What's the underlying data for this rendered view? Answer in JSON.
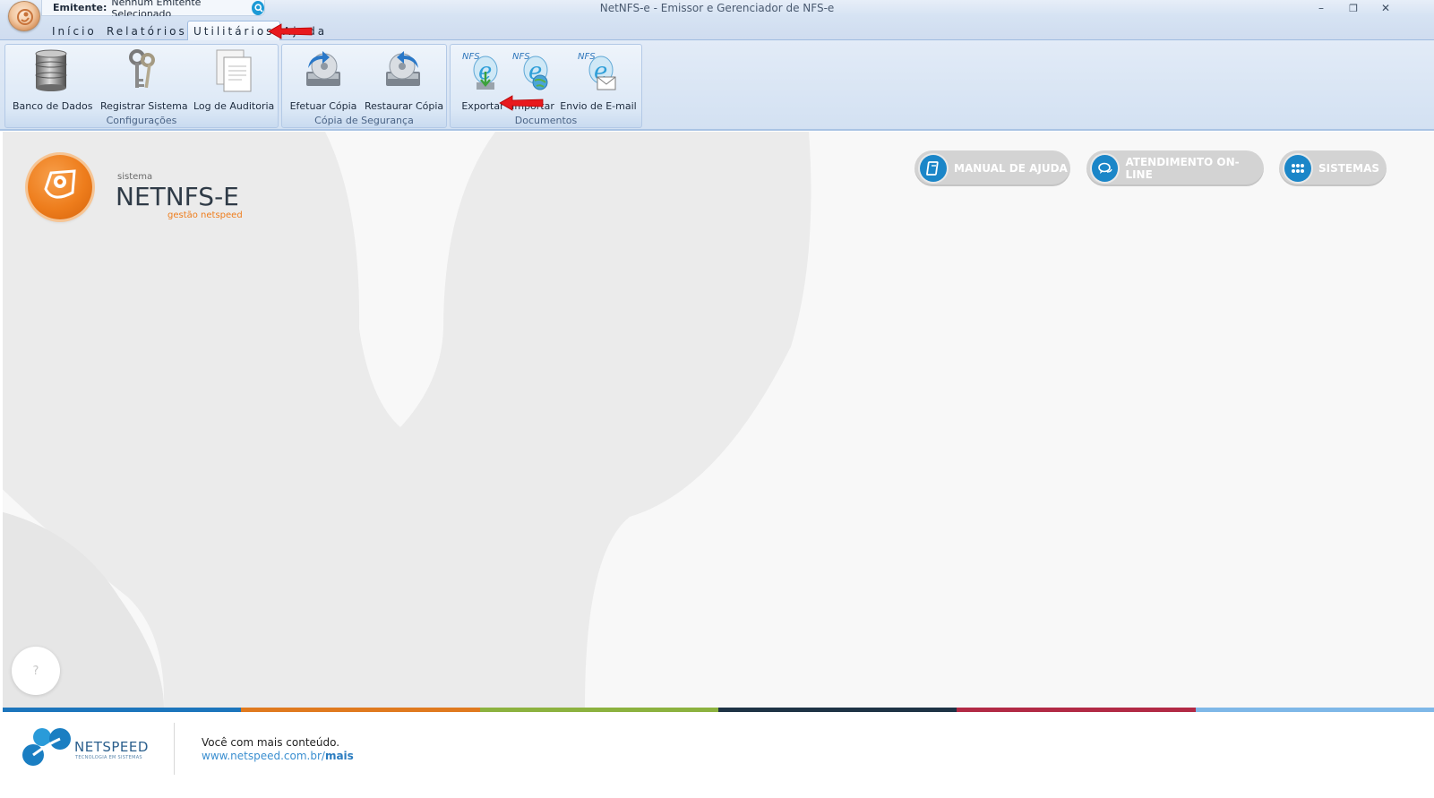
{
  "window": {
    "title": "NetNFS-e - Emissor e Gerenciador de NFS-e",
    "minimize_glyph": "–",
    "restore_glyph": "❐",
    "close_glyph": "✕"
  },
  "emitente": {
    "label": "Emitente:",
    "value": "Nenhum Emitente Selecionado"
  },
  "tabs": [
    {
      "label": "Início",
      "active": false
    },
    {
      "label": "Relatórios",
      "active": false
    },
    {
      "label": "Utilitários",
      "active": true
    },
    {
      "label": "Ajuda",
      "active": false
    }
  ],
  "ribbon": {
    "groups": [
      {
        "title": "Configurações",
        "buttons": [
          {
            "label": "Banco de Dados",
            "icon": "database-icon"
          },
          {
            "label": "Registrar Sistema",
            "icon": "keys-icon"
          },
          {
            "label": "Log de Auditoria",
            "icon": "document-log-icon"
          }
        ]
      },
      {
        "title": "Cópia de Segurança",
        "buttons": [
          {
            "label": "Efetuar Cópia",
            "icon": "backup-disc-icon"
          },
          {
            "label": "Restaurar Cópia",
            "icon": "restore-disc-icon"
          }
        ]
      },
      {
        "title": "Documentos",
        "buttons": [
          {
            "label": "Exportar",
            "icon": "nfse-export-icon"
          },
          {
            "label": "Importar",
            "icon": "nfse-import-icon"
          },
          {
            "label": "Envio de E-mail",
            "icon": "nfse-email-icon"
          }
        ]
      }
    ]
  },
  "product": {
    "small": "sistema",
    "name": "NETNFS-E",
    "sub": "gestão netspeed"
  },
  "actions": [
    {
      "label": "MANUAL DE AJUDA",
      "icon": "book-icon"
    },
    {
      "label": "ATENDIMENTO ON-LINE",
      "icon": "chat-icon"
    },
    {
      "label": "SISTEMAS",
      "icon": "grid-dots-icon"
    }
  ],
  "help_bubble": "?",
  "footer": {
    "brand": "NETSPEED",
    "tagline": "TECNOLOGIA EM SISTEMAS",
    "message": "Você com mais conteúdo.",
    "link_prefix": "www.netspeed.com.br/",
    "link_bold": "mais"
  },
  "colors": {
    "accent_orange": "#ee7d1c",
    "accent_blue": "#1b86c8",
    "stripe": [
      "#1c75bc",
      "#e07a1f",
      "#8cb23f",
      "#1e3345",
      "#b22a45",
      "#7fb8e8"
    ]
  }
}
